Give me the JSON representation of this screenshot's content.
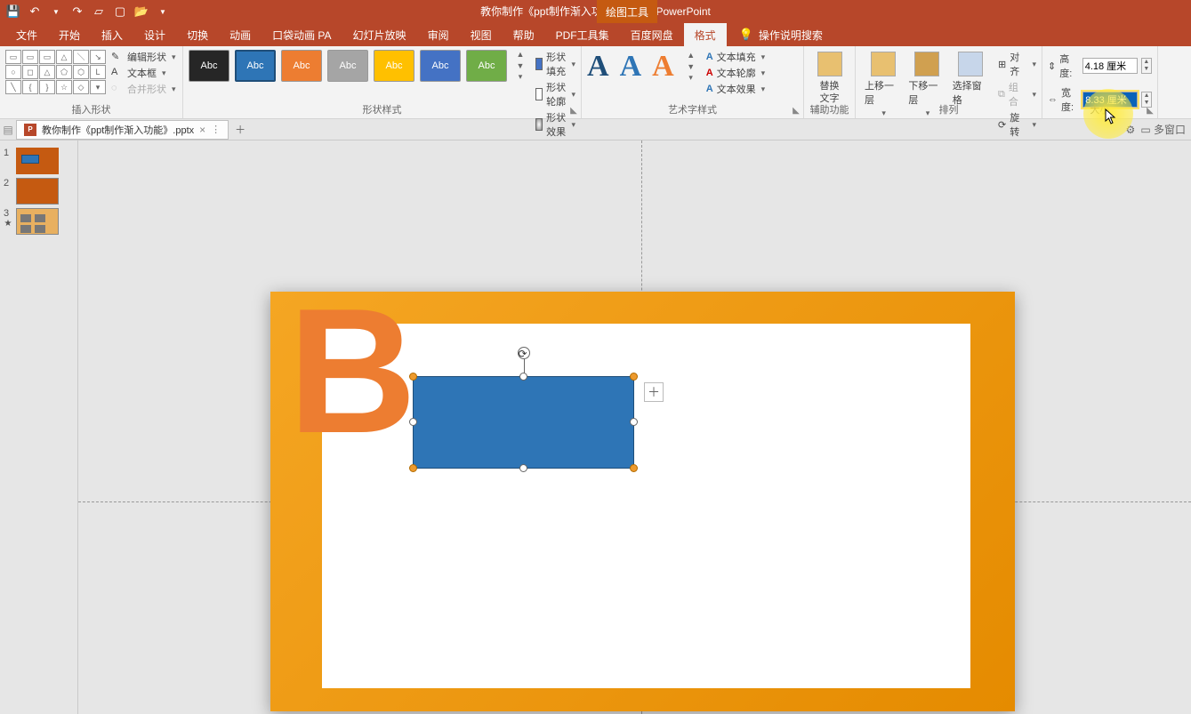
{
  "title": "教你制作《ppt制作渐入功能》.pptx - PowerPoint",
  "context_tab": "绘图工具",
  "tabs": [
    "文件",
    "开始",
    "插入",
    "设计",
    "切换",
    "动画",
    "口袋动画 PA",
    "幻灯片放映",
    "审阅",
    "视图",
    "帮助",
    "PDF工具集",
    "百度网盘",
    "格式"
  ],
  "active_tab": "格式",
  "tell_me": "操作说明搜索",
  "doc_tab": "教你制作《ppt制作渐入功能》.pptx",
  "groups": {
    "insert_shapes": {
      "label": "插入形状",
      "edit_shape": "编辑形状",
      "text_box": "文本框",
      "merge": "合并形状"
    },
    "shape_styles": {
      "label": "形状样式",
      "swatch_text": "Abc",
      "fill": "形状填充",
      "outline": "形状轮廓",
      "effects": "形状效果"
    },
    "wordart": {
      "label": "艺术字样式",
      "glyph": "A",
      "t_fill": "文本填充",
      "t_outline": "文本轮廓",
      "t_effects": "文本效果"
    },
    "alt": {
      "label": "辅助功能",
      "btn_l1": "替换",
      "btn_l2": "文字"
    },
    "arrange": {
      "label": "排列",
      "fwd": "上移一层",
      "back": "下移一层",
      "pane": "选择窗格",
      "align": "对齐",
      "group": "组合",
      "rotate": "旋转"
    },
    "size": {
      "label": "大小",
      "h_lbl": "高度:",
      "w_lbl": "宽度:",
      "h_val": "4.18 厘米",
      "w_val": "8.33 厘米"
    }
  },
  "thumbs": {
    "n1": "1",
    "n2": "2",
    "n3": "3"
  },
  "right_btns": {
    "gear": "⚙",
    "multi": "多窗口"
  }
}
